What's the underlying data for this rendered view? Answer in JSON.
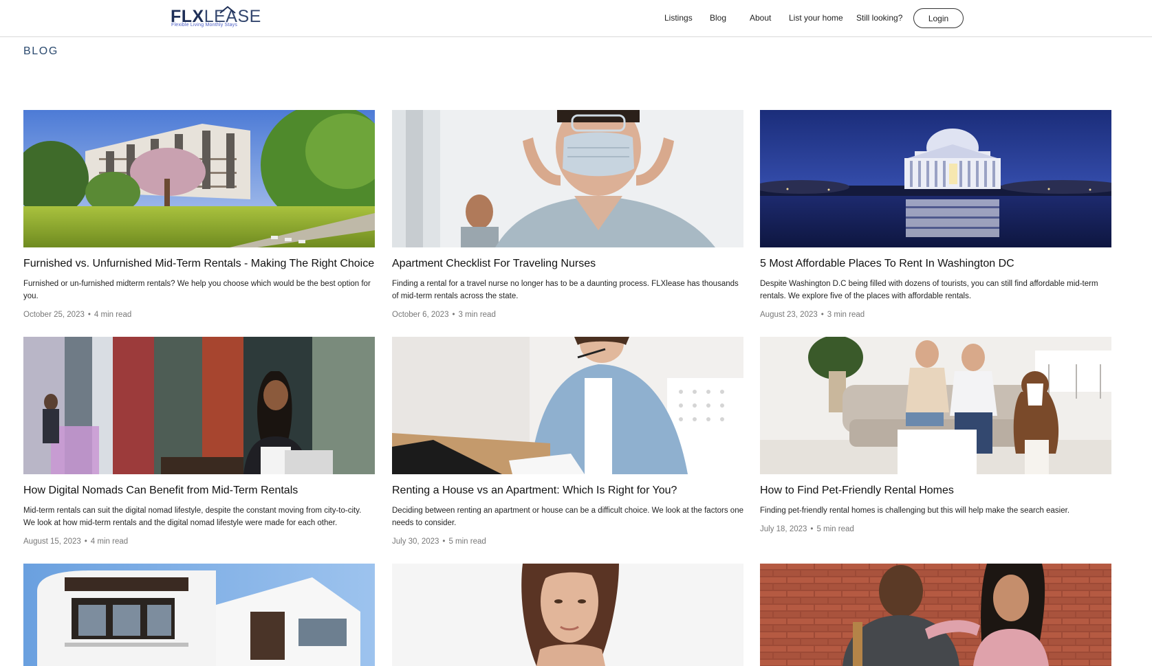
{
  "header": {
    "logo_bold": "FLX",
    "logo_light": "LEASE",
    "logo_tagline": "Flexible Living Monthly Stays",
    "nav": [
      {
        "label": "Listings"
      },
      {
        "label": "Blog"
      },
      {
        "label": "About"
      },
      {
        "label": "List your home"
      },
      {
        "label": "Still looking?"
      }
    ],
    "login_label": "Login"
  },
  "page": {
    "title": "BLOG"
  },
  "posts": [
    {
      "title": "Furnished vs. Unfurnished Mid-Term Rentals - Making The Right Choice",
      "description": "Furnished or un-furnished midterm rentals? We help you choose which would be the best option for you.",
      "date": "October 25, 2023",
      "read_time": "4 min read",
      "image": "garden-apartments-photo"
    },
    {
      "title": "Apartment Checklist For Traveling Nurses",
      "description": "Finding a rental for a travel nurse no longer has to be a daunting process. FLXlease has thousands of mid-term rentals across the state.",
      "date": "October 6, 2023",
      "read_time": "3 min read",
      "image": "nurse-mask-photo"
    },
    {
      "title": "5 Most Affordable Places To Rent In Washington DC",
      "description": "Despite Washington D.C being filled with dozens of tourists, you can still find affordable mid-term rentals. We explore five of the places with affordable rentals.",
      "date": "August 23, 2023",
      "read_time": "3 min read",
      "image": "jefferson-memorial-photo"
    },
    {
      "title": "How Digital Nomads Can Benefit from Mid-Term Rentals",
      "description": "Mid-term rentals can suit the digital nomad lifestyle, despite the constant moving from city-to-city. We look at how mid-term rentals and the digital nomad lifestyle were made for each other.",
      "date": "August 15, 2023",
      "read_time": "4 min read",
      "image": "digital-nomad-photo"
    },
    {
      "title": "Renting a House vs an Apartment: Which Is Right for You?",
      "description": "Deciding between renting an apartment or house can be a difficult choice. We look at the factors one needs to consider.",
      "date": "July 30, 2023",
      "read_time": "5 min read",
      "image": "woman-laptop-photo"
    },
    {
      "title": "How to Find Pet-Friendly Rental Homes",
      "description": "Finding pet-friendly rental homes is challenging but this will help make the search easier.",
      "date": "July 18, 2023",
      "read_time": "5 min read",
      "image": "couple-dog-photo"
    },
    {
      "title": "",
      "description": "",
      "date": "",
      "read_time": "",
      "image": "modern-house-photo"
    },
    {
      "title": "",
      "description": "",
      "date": "",
      "read_time": "",
      "image": "woman-thinking-photo"
    },
    {
      "title": "",
      "description": "",
      "date": "",
      "read_time": "",
      "image": "couple-brick-wall-photo"
    }
  ],
  "colors": {
    "brand_navy": "#1e2f57",
    "page_title": "#2b4a6f",
    "meta_gray": "#777777",
    "divider": "#d9d9d9"
  }
}
